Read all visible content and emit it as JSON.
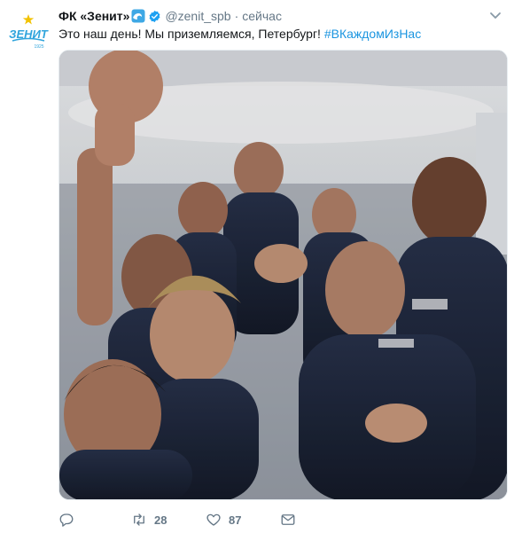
{
  "tweet": {
    "author_name": "ФК «Зенит»",
    "handle": "@zenit_spb",
    "separator": "·",
    "time": "сейчас",
    "text": "Это наш день! Мы приземляемся, Петербург! ",
    "hashtag": "#ВКаждомИзНас",
    "avatar_text": "ЗЕНИТ",
    "avatar_year": "1925"
  },
  "actions": {
    "reply_count": "",
    "retweet_count": "28",
    "like_count": "87"
  },
  "icons": {
    "wave": "wave-emoji-icon",
    "verified": "verified-badge-icon",
    "caret": "chevron-down-icon",
    "reply": "reply-icon",
    "retweet": "retweet-icon",
    "like": "heart-icon",
    "dm": "envelope-icon"
  },
  "colors": {
    "brand": "#1b95e0",
    "muted": "#657786",
    "avatar": "#2fa4dc"
  }
}
